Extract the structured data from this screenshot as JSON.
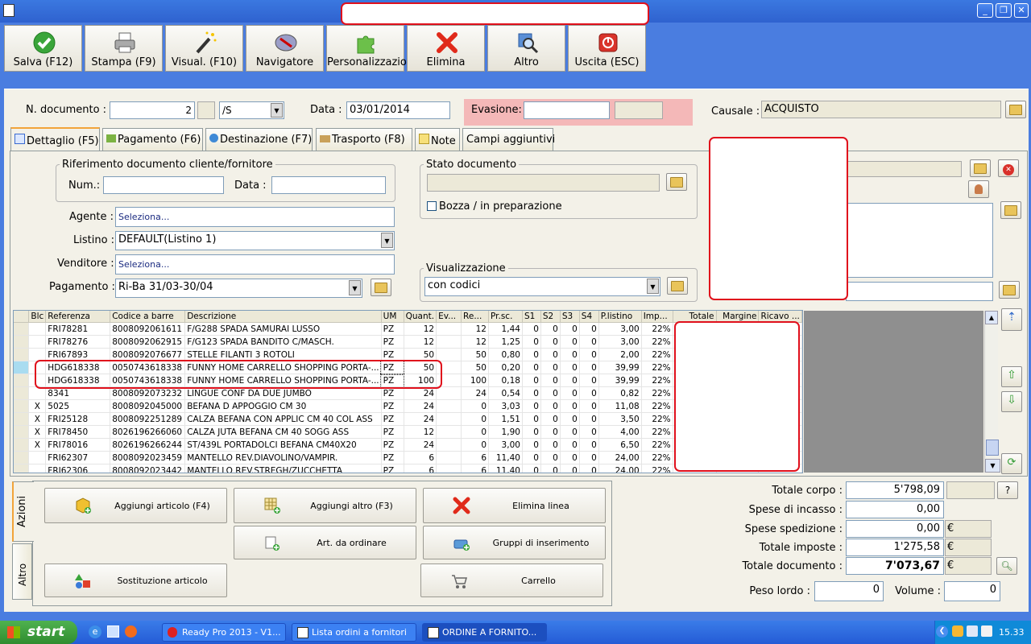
{
  "window": {
    "title": ""
  },
  "toolbar": [
    {
      "label": "Salva (F12)",
      "icon": "check-icon"
    },
    {
      "label": "Stampa (F9)",
      "icon": "printer-icon"
    },
    {
      "label": "Visual. (F10)",
      "icon": "magic-wand-icon"
    },
    {
      "label": "Navigatore",
      "icon": "compass-icon"
    },
    {
      "label": "Personalizzazioni",
      "icon": "puzzle-icon"
    },
    {
      "label": "Elimina",
      "icon": "delete-x-icon"
    },
    {
      "label": "Altro",
      "icon": "magnifier-icon"
    },
    {
      "label": "Uscita (ESC)",
      "icon": "exit-icon"
    }
  ],
  "header": {
    "ndoc_label": "N. documento :",
    "ndoc_value": "2",
    "series_value": "/S",
    "data_label": "Data :",
    "data_value": "03/01/2014",
    "evasione_label": "Evasione:",
    "evasione_value": "",
    "causale_label": "Causale :",
    "causale_value": "ACQUISTO"
  },
  "tabs": [
    "Dettaglio (F5)",
    "Pagamento (F6)",
    "Destinazione (F7)",
    "Trasporto (F8)",
    "Note",
    "Campi aggiuntivi"
  ],
  "form": {
    "rif_title": "Riferimento documento cliente/fornitore",
    "num_label": "Num.:",
    "num_value": "",
    "data_label": "Data :",
    "data_value": "",
    "stato_title": "Stato documento",
    "bozza_label": "Bozza / in preparazione",
    "agente_label": "Agente :",
    "agente_value": "Seleziona...",
    "listino_label": "Listino :",
    "listino_value": "DEFAULT(Listino 1)",
    "venditore_label": "Venditore :",
    "venditore_value": "Seleziona...",
    "pagamento_label": "Pagamento :",
    "pagamento_value": "Ri-Ba 31/03-30/04",
    "visual_title": "Visualizzazione",
    "visual_value": "con codici"
  },
  "grid": {
    "columns": [
      "Blc",
      "Referenza",
      "Codice a barre",
      "Descrizione",
      "UM",
      "Quant.",
      "Ev...",
      "Re...",
      "Pr.sc.",
      "S1",
      "S2",
      "S3",
      "S4",
      "P.listino",
      "Imp...",
      "Totale",
      "Margine",
      "Ricavo ..."
    ],
    "rows": [
      [
        "",
        "FRI78281",
        "8008092061611",
        "F/G288 SPADA SAMURAI LUSSO",
        "PZ",
        "12",
        "",
        "12",
        "1,44",
        "0",
        "0",
        "0",
        "0",
        "3,00",
        "22%"
      ],
      [
        "",
        "FRI78276",
        "8008092062915",
        "F/G123 SPADA BANDITO C/MASCH.",
        "PZ",
        "12",
        "",
        "12",
        "1,25",
        "0",
        "0",
        "0",
        "0",
        "3,00",
        "22%"
      ],
      [
        "",
        "FRI67893",
        "8008092076677",
        "STELLE FILANTI 3 ROTOLI",
        "PZ",
        "50",
        "",
        "50",
        "0,80",
        "0",
        "0",
        "0",
        "0",
        "2,00",
        "22%"
      ],
      [
        "",
        "HDG618338",
        "0050743618338",
        "FUNNY HOME CARRELLO SHOPPING PORTA-...",
        "PZ",
        "50",
        "",
        "50",
        "0,20",
        "0",
        "0",
        "0",
        "0",
        "39,99",
        "22%"
      ],
      [
        "",
        "HDG618338",
        "0050743618338",
        "FUNNY HOME CARRELLO SHOPPING PORTA-...",
        "PZ",
        "100",
        "",
        "100",
        "0,18",
        "0",
        "0",
        "0",
        "0",
        "39,99",
        "22%"
      ],
      [
        "",
        "8341",
        "8008092073232",
        "LINGUE CONF DA DUE JUMBO",
        "PZ",
        "24",
        "",
        "24",
        "0,54",
        "0",
        "0",
        "0",
        "0",
        "0,82",
        "22%"
      ],
      [
        "X",
        "5025",
        "8008092045000",
        "BEFANA D APPOGGIO CM 30",
        "PZ",
        "24",
        "",
        "0",
        "3,03",
        "0",
        "0",
        "0",
        "0",
        "11,08",
        "22%"
      ],
      [
        "X",
        "FRI25128",
        "8008092251289",
        "CALZA BEFANA CON APPLIC CM 40 COL ASS",
        "PZ",
        "24",
        "",
        "0",
        "1,51",
        "0",
        "0",
        "0",
        "0",
        "3,50",
        "22%"
      ],
      [
        "X",
        "FRI78450",
        "8026196266060",
        "CALZA JUTA BEFANA CM 40 SOGG ASS",
        "PZ",
        "12",
        "",
        "0",
        "1,90",
        "0",
        "0",
        "0",
        "0",
        "4,00",
        "22%"
      ],
      [
        "X",
        "FRI78016",
        "8026196266244",
        "ST/439L PORTADOLCI BEFANA CM40X20",
        "PZ",
        "24",
        "",
        "0",
        "3,00",
        "0",
        "0",
        "0",
        "0",
        "6,50",
        "22%"
      ],
      [
        "",
        "FRI62307",
        "8008092023459",
        "MANTELLO REV.DIAVOLINO/VAMPIR.",
        "PZ",
        "6",
        "",
        "6",
        "11,40",
        "0",
        "0",
        "0",
        "0",
        "24,00",
        "22%"
      ],
      [
        "",
        "FRI62306",
        "8008092023442",
        "MANTELLO REV.STREGH/ZUCCHETTA",
        "PZ",
        "6",
        "",
        "6",
        "11,40",
        "0",
        "0",
        "0",
        "0",
        "24,00",
        "22%"
      ]
    ]
  },
  "actions": {
    "side_tabs": [
      "Azioni",
      "Altro"
    ],
    "aggiungi_articolo": "Aggiungi articolo (F4)",
    "aggiungi_altro": "Aggiungi altro (F3)",
    "elimina_linea": "Elimina linea",
    "art_ordinare": "Art. da ordinare",
    "gruppi": "Gruppi di inserimento",
    "sostituzione": "Sostituzione articolo",
    "carrello": "Carrello"
  },
  "totals": {
    "corpo_label": "Totale corpo :",
    "corpo_value": "5'798,09",
    "incasso_label": "Spese di incasso :",
    "incasso_value": "0,00",
    "spedizione_label": "Spese spedizione :",
    "spedizione_value": "0,00",
    "imposte_label": "Totale imposte :",
    "imposte_value": "1'275,58",
    "documento_label": "Totale documento :",
    "documento_value": "7'073,67",
    "euro": "€",
    "help": "?",
    "peso_label": "Peso lordo :",
    "peso_value": "0",
    "volume_label": "Volume :",
    "volume_value": "0"
  },
  "taskbar": {
    "start": "start",
    "tasks": [
      "Ready Pro 2013 - V1...",
      "Lista ordini a fornitori",
      "ORDINE A FORNITO..."
    ],
    "clock": "15.33"
  },
  "colors": {
    "highlight": "#e0101c",
    "evasione_bg": "#f4b8b8",
    "frame": "#f3f1e8"
  }
}
